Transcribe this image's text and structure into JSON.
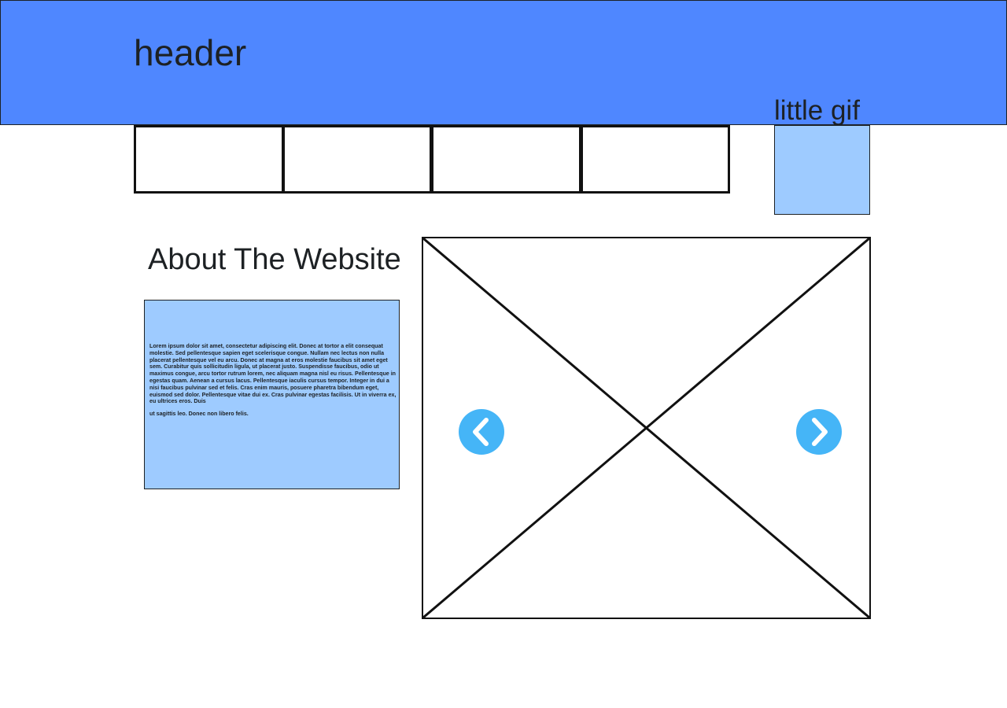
{
  "header": {
    "title": "header"
  },
  "nav": {
    "items": [
      {
        "label": ""
      },
      {
        "label": ""
      },
      {
        "label": ""
      },
      {
        "label": ""
      }
    ]
  },
  "gif": {
    "label": "little gif"
  },
  "about": {
    "title": "About The Website",
    "paragraphs": [
      "Lorem ipsum dolor sit amet, consectetur adipiscing elit. Donec at tortor a elit consequat molestie. Sed pellentesque sapien eget scelerisque congue. Nullam nec lectus non nulla placerat pellentesque vel eu arcu. Donec at magna at eros molestie faucibus sit amet eget sem. Curabitur quis sollicitudin ligula, ut placerat justo. Suspendisse faucibus, odio ut maximus congue, arcu tortor rutrum lorem, nec aliquam magna nisl eu risus. Pellentesque in egestas quam. Aenean a cursus lacus. Pellentesque iaculis cursus tempor. Integer in dui a nisi faucibus pulvinar sed et felis. Cras enim mauris, posuere pharetra bibendum eget, euismod sed dolor. Pellentesque vitae dui ex. Cras pulvinar egestas facilisis. Ut in viverra ex, eu ultrices eros. Duis",
      "ut sagittis leo. Donec non libero felis."
    ]
  },
  "carousel": {
    "prev_icon": "chevron-left-icon",
    "next_icon": "chevron-right-icon"
  },
  "colors": {
    "header_bg": "#4f87ff",
    "box_bg": "#9ecbff",
    "arrow_bg": "#45b5f7"
  }
}
